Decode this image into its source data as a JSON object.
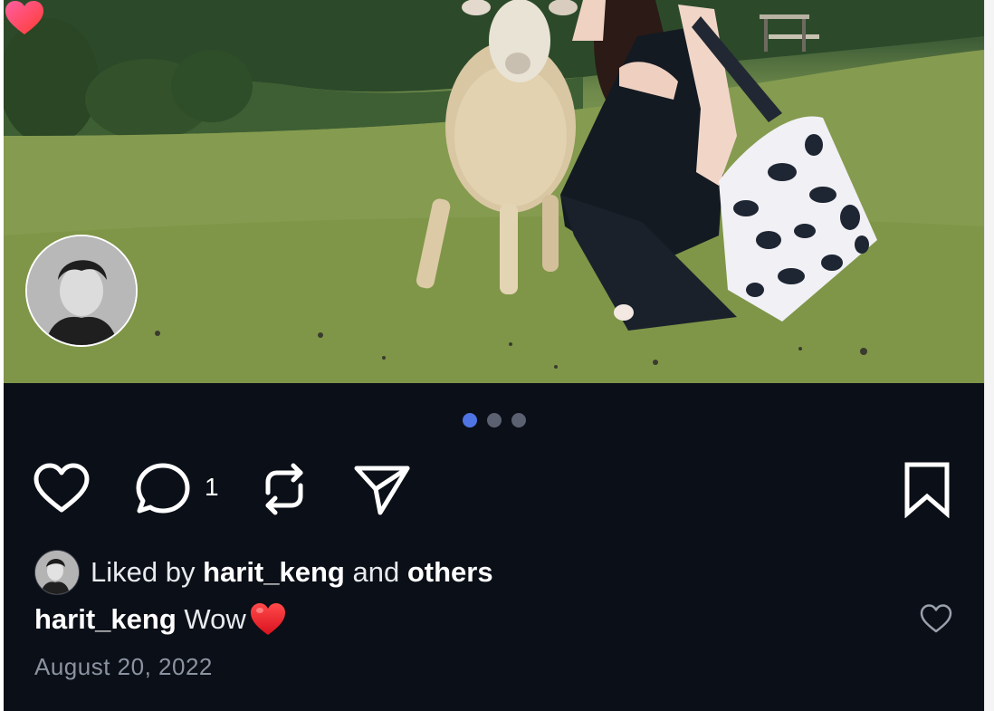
{
  "post": {
    "image": {
      "description": "sheep-photo",
      "carousel_total": 3,
      "carousel_active": 1
    },
    "tagged_user": {
      "name": "harit_keng",
      "reaction": "heart"
    },
    "actions": {
      "like_icon": "heart-outline-icon",
      "comment_icon": "comment-bubble-icon",
      "comment_count": "1",
      "repost_icon": "repost-icon",
      "share_icon": "send-icon",
      "save_icon": "bookmark-icon"
    },
    "likes": {
      "prefix": "Liked by ",
      "user": "harit_keng",
      "joiner": " and ",
      "others": "others"
    },
    "caption": {
      "username": "harit_keng",
      "text": " Wow"
    },
    "date": "August 20, 2022"
  },
  "colors": {
    "background": "#0b0f17",
    "active_dot": "#4f74e3",
    "inactive_dot": "#5b6170",
    "heart_red": "#e81f2a",
    "date_text": "#8b93a1"
  }
}
